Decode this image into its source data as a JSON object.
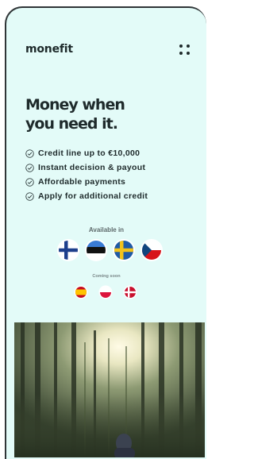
{
  "brand": {
    "logo": "monefit"
  },
  "hero": {
    "line1": "Money when",
    "line2": "you need it."
  },
  "features": [
    {
      "label": "Credit line up to €10,000",
      "icon": "check-circle-icon"
    },
    {
      "label": "Instant decision & payout",
      "icon": "check-circle-icon"
    },
    {
      "label": "Affordable payments",
      "icon": "check-circle-icon"
    },
    {
      "label": "Apply for additional credit",
      "icon": "check-circle-icon"
    }
  ],
  "availability": {
    "available_label": "Available in",
    "available_flags": [
      "finland-flag-icon",
      "estonia-flag-icon",
      "sweden-flag-icon",
      "czech-republic-flag-icon"
    ],
    "coming_label": "Coming soon",
    "coming_flags": [
      "spain-flag-icon",
      "poland-flag-icon",
      "denmark-flag-icon"
    ]
  },
  "colors": {
    "background": "#e3fbf8",
    "text": "#1e2a2b"
  }
}
